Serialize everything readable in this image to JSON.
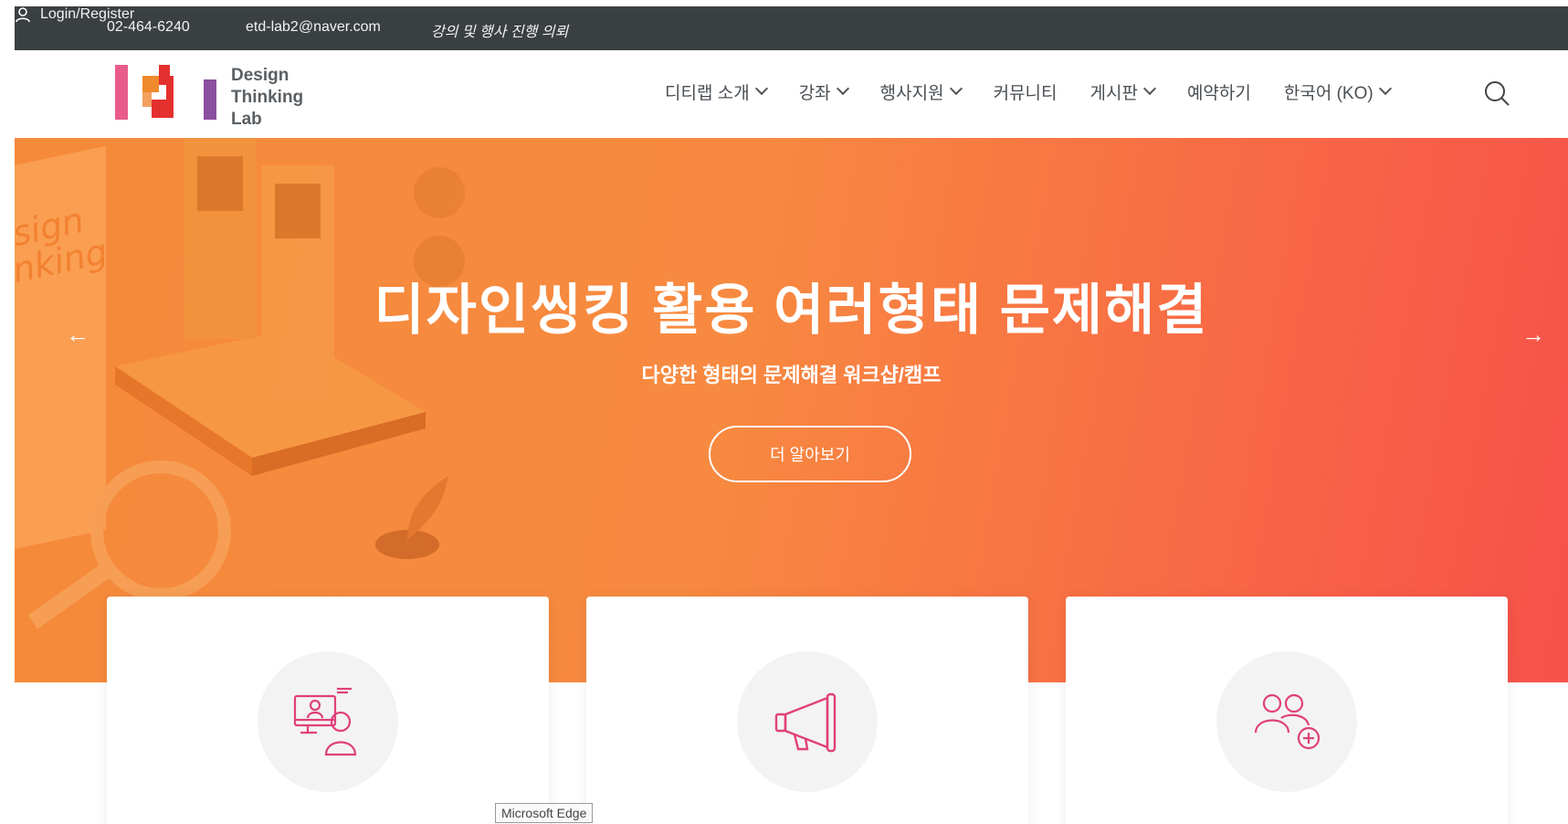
{
  "topbar": {
    "phone": "02-464-6240",
    "email": "etd-lab2@naver.com",
    "request": "강의 및 행사 진행 의뢰",
    "login": "Login/Register"
  },
  "logo": {
    "line1": "Design",
    "line2": "Thinking",
    "line3": "Lab"
  },
  "nav": {
    "items": [
      {
        "label": "디티랩 소개",
        "dropdown": true
      },
      {
        "label": "강좌",
        "dropdown": true
      },
      {
        "label": "행사지원",
        "dropdown": true
      },
      {
        "label": "커뮤니티",
        "dropdown": false
      },
      {
        "label": "게시판",
        "dropdown": true
      },
      {
        "label": "예약하기",
        "dropdown": false
      },
      {
        "label": "한국어 (KO)",
        "dropdown": true
      }
    ]
  },
  "hero": {
    "title": "디자인씽킹 활용 여러형태 문제해결",
    "subtitle": "다양한 형태의 문제해결 워크샵/캠프",
    "button": "더 알아보기",
    "prev": "←",
    "next": "→"
  },
  "cards": [
    {
      "icon": "online-lecture-icon"
    },
    {
      "icon": "megaphone-icon"
    },
    {
      "icon": "add-group-icon"
    }
  ],
  "tooltip": "Microsoft Edge",
  "colors": {
    "topbar": "#3a3f42",
    "hero_start": "#f58a3a",
    "hero_end": "#f6514a",
    "icon_pink": "#e0407a",
    "logo_pink": "#e85b8c",
    "logo_orange": "#f08a2c",
    "logo_red": "#e53030",
    "logo_purple": "#8a4f9e"
  }
}
